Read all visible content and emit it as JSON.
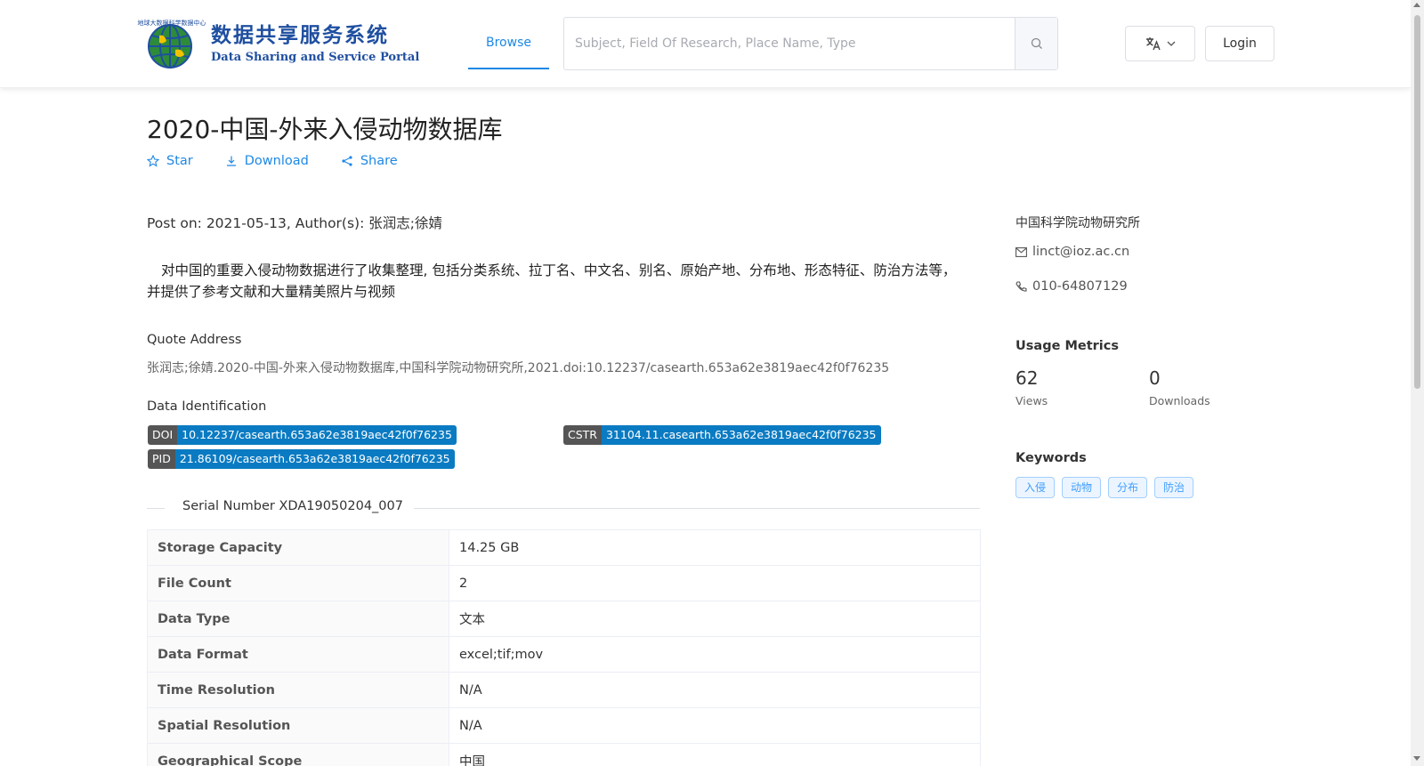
{
  "header": {
    "logo_cn": "数据共享服务系统",
    "logo_en": "Data Sharing and Service Portal",
    "nav_browse": "Browse",
    "search_placeholder": "Subject, Field Of Research, Place Name, Type",
    "login": "Login"
  },
  "dataset": {
    "title": "2020-中国-外来入侵动物数据库",
    "actions": {
      "star": "Star",
      "download": "Download",
      "share": "Share"
    },
    "post_on": "Post on: 2021-05-13, Author(s): 张润志;徐婧",
    "description": "对中国的重要入侵动物数据进行了收集整理, 包括分类系统、拉丁名、中文名、别名、原始产地、分布地、形态特征、防治方法等，并提供了参考文献和大量精美照片与视频",
    "quote_label": "Quote Address",
    "quote": "张润志;徐婧.2020-中国-外来入侵动物数据库,中国科学院动物研究所,2021.doi:10.12237/casearth.653a62e3819aec42f0f76235",
    "identification_label": "Data Identification",
    "badges": {
      "doi_label": "DOI",
      "doi_value": "10.12237/casearth.653a62e3819aec42f0f76235",
      "cstr_label": "CSTR",
      "cstr_value": "31104.11.casearth.653a62e3819aec42f0f76235",
      "pid_label": "PID",
      "pid_value": "21.86109/casearth.653a62e3819aec42f0f76235"
    },
    "serial_number": "Serial Number XDA19050204_007",
    "table": [
      {
        "key": "Storage Capacity",
        "value": "14.25 GB"
      },
      {
        "key": "File Count",
        "value": "2"
      },
      {
        "key": "Data Type",
        "value": "文本"
      },
      {
        "key": "Data Format",
        "value": "excel;tif;mov"
      },
      {
        "key": "Time Resolution",
        "value": "N/A"
      },
      {
        "key": "Spatial Resolution",
        "value": "N/A"
      },
      {
        "key": "Geographical Scope",
        "value": "中国"
      }
    ]
  },
  "sidebar": {
    "organization": "中国科学院动物研究所",
    "email": "linct@ioz.ac.cn",
    "phone": "010-64807129",
    "metrics_title": "Usage Metrics",
    "views_value": "62",
    "views_label": "Views",
    "downloads_value": "0",
    "downloads_label": "Downloads",
    "keywords_title": "Keywords",
    "keywords": [
      "入侵",
      "动物",
      "分布",
      "防治"
    ]
  },
  "colors": {
    "accent": "#1e88e5",
    "badge_value": "#0a7bc2",
    "badge_label": "#555555",
    "logo": "#1f4fa0"
  }
}
